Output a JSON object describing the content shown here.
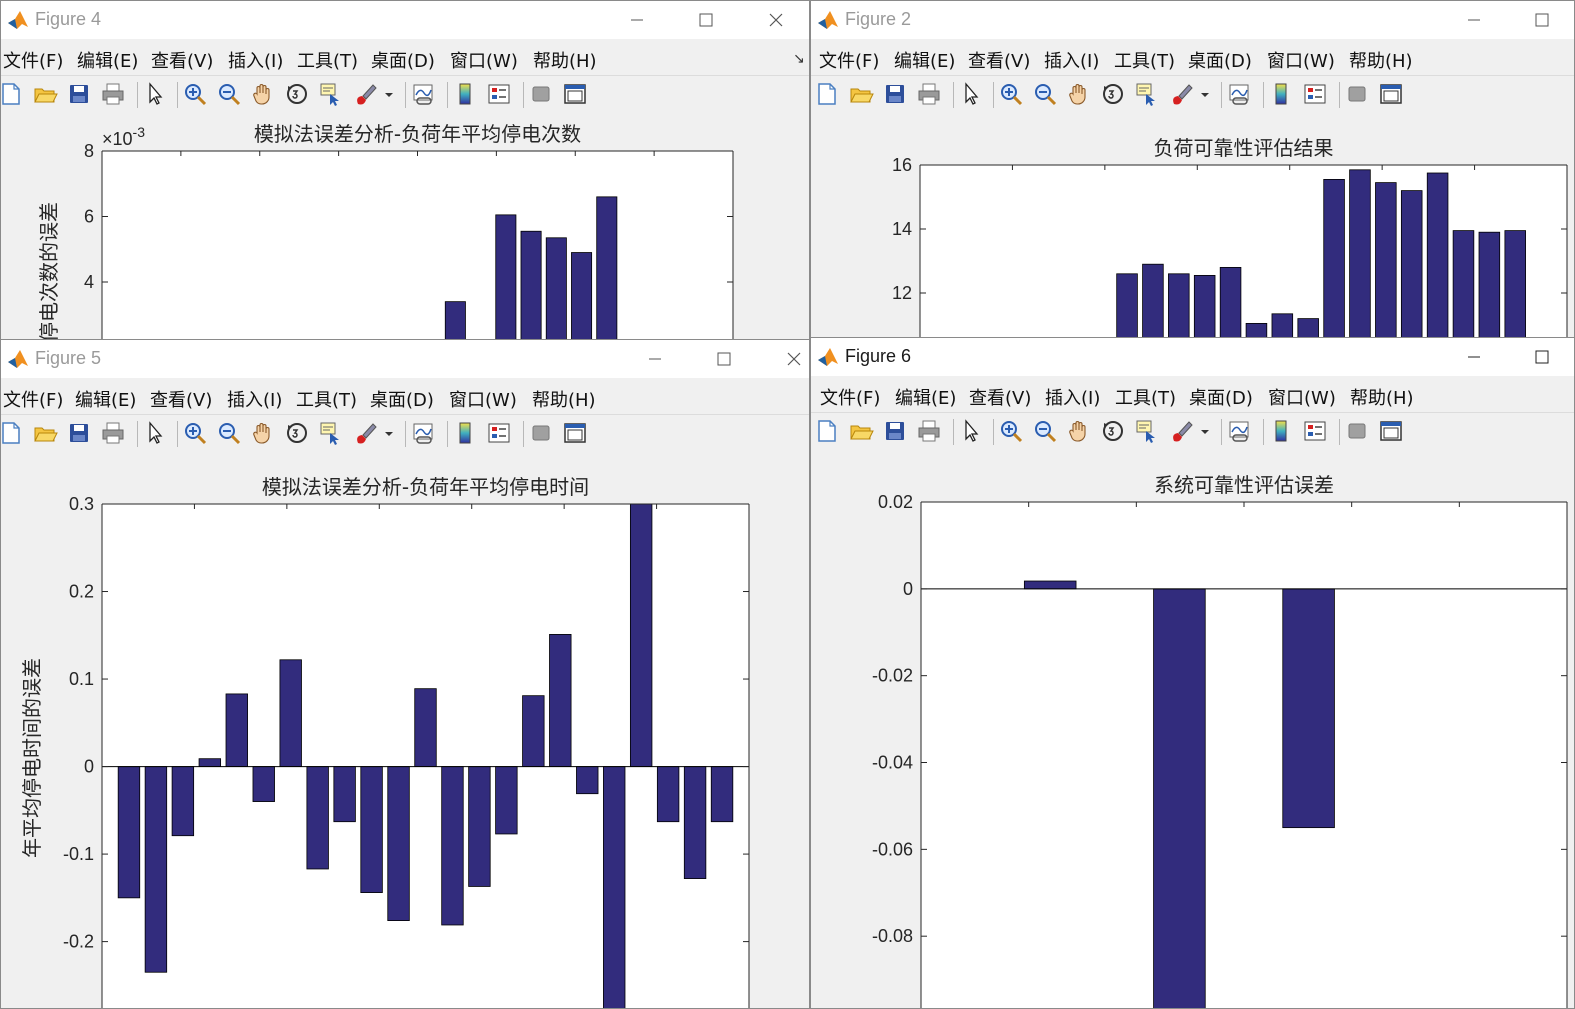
{
  "menu": [
    "文件(F)",
    "编辑(E)",
    "查看(V)",
    "插入(I)",
    "工具(T)",
    "桌面(D)",
    "窗口(W)",
    "帮助(H)"
  ],
  "colors": {
    "bar": "#322c7d",
    "accent": "#f09020"
  },
  "windows": {
    "fig4": {
      "title": "Figure 4",
      "chart_data": {
        "type": "bar",
        "title": "模拟法误差分析-负荷年平均停电次数",
        "ylabel": "年平均停电次数的误差",
        "exponent_label": "×10",
        "exponent": "-3",
        "yticks": [
          "8",
          "6",
          "4"
        ],
        "ylim": [
          0,
          8
        ],
        "values": [
          0,
          0,
          0,
          0,
          0,
          0,
          0,
          0,
          0,
          0,
          0,
          0,
          0,
          3.4,
          0,
          6.05,
          5.55,
          5.35,
          4.9,
          6.6,
          0,
          0,
          0,
          0
        ]
      }
    },
    "fig2": {
      "title": "Figure 2",
      "chart_data": {
        "type": "bar",
        "title": "负荷可靠性评估结果",
        "yticks": [
          "16",
          "14",
          "12"
        ],
        "ylim": [
          10,
          16
        ],
        "values": [
          0,
          0,
          0,
          0,
          0,
          0,
          0,
          12.6,
          12.9,
          12.6,
          12.55,
          12.8,
          11.05,
          11.35,
          11.2,
          15.55,
          15.85,
          15.45,
          15.2,
          15.75,
          13.95,
          13.9,
          13.95,
          0
        ]
      }
    },
    "fig5": {
      "title": "Figure 5",
      "chart_data": {
        "type": "bar",
        "title": "模拟法误差分析-负荷年平均停电时间",
        "ylabel": "年平均停电时间的误差",
        "yticks": [
          "0.3",
          "0.2",
          "0.1",
          "0",
          "-0.1",
          "-0.2"
        ],
        "ylim": [
          -0.285,
          0.3
        ],
        "values": [
          -0.15,
          -0.235,
          -0.079,
          0.009,
          0.083,
          -0.04,
          0.122,
          -0.117,
          -0.063,
          -0.144,
          -0.176,
          0.089,
          -0.181,
          -0.137,
          -0.077,
          0.081,
          0.151,
          -0.031,
          -0.28,
          0.3,
          -0.063,
          -0.128,
          -0.063
        ]
      }
    },
    "fig6": {
      "title": "Figure 6",
      "chart_data": {
        "type": "bar",
        "title": "系统可靠性评估误差",
        "yticks": [
          "0.02",
          "0",
          "-0.02",
          "-0.04",
          "-0.06",
          "-0.08"
        ],
        "ylim": [
          -0.097,
          0.02
        ],
        "values": [
          0.0018,
          -0.097,
          -0.055,
          0
        ]
      }
    }
  }
}
